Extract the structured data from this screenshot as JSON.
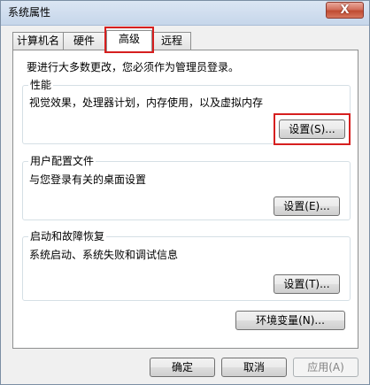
{
  "window": {
    "title": "系统属性",
    "close_label": "X"
  },
  "tabs": [
    {
      "label": "计算机名",
      "active": false
    },
    {
      "label": "硬件",
      "active": false
    },
    {
      "label": "高级",
      "active": true
    },
    {
      "label": "远程",
      "active": false
    }
  ],
  "panel": {
    "intro": "要进行大多数更改，您必须作为管理员登录。",
    "performance": {
      "legend": "性能",
      "desc": "视觉效果，处理器计划，内存使用，以及虚拟内存",
      "button": "设置(S)..."
    },
    "user_profiles": {
      "legend": "用户配置文件",
      "desc": "与您登录有关的桌面设置",
      "button": "设置(E)..."
    },
    "startup_recovery": {
      "legend": "启动和故障恢复",
      "desc": "系统启动、系统失败和调试信息",
      "button": "设置(T)..."
    },
    "env_button": "环境变量(N)..."
  },
  "footer": {
    "ok": "确定",
    "cancel": "取消",
    "apply": "应用(A)"
  },
  "colors": {
    "highlight": "#d61f1f"
  }
}
